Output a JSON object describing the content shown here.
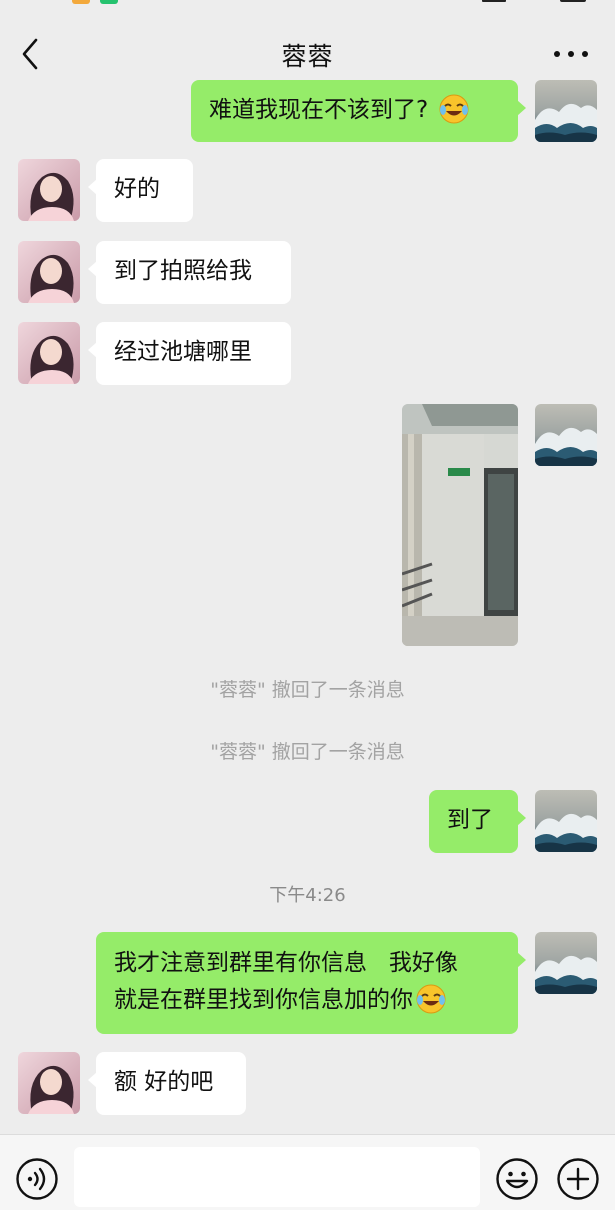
{
  "header": {
    "title": "蓉蓉"
  },
  "messages": [
    {
      "side": "out",
      "text": "难道我现在不该到了?",
      "emoji": "laughing-crying-emoji"
    },
    {
      "side": "in",
      "text": "好的"
    },
    {
      "side": "in",
      "text": "到了拍照给我"
    },
    {
      "side": "in",
      "text": "经过池塘哪里"
    },
    {
      "side": "out",
      "type": "photo"
    },
    {
      "side": "out",
      "text": "到了"
    },
    {
      "side": "out",
      "line1": "我才注意到群里有你信息   我好像",
      "line2": "就是在群里找到你信息加的你",
      "emoji": "laughing-crying-emoji"
    },
    {
      "side": "in",
      "text": "额 好的吧"
    }
  ],
  "system": {
    "recall1": "\"蓉蓉\" 撤回了一条消息",
    "recall2": "\"蓉蓉\" 撤回了一条消息",
    "time": "下午4:26"
  },
  "icons": {
    "back": "chevron-left-icon",
    "more": "more-dots-icon",
    "voice": "voice-icon",
    "emoji": "smiley-icon",
    "plus": "plus-icon"
  },
  "colors": {
    "background": "#ededed",
    "outgoing_bubble": "#95ec69",
    "incoming_bubble": "#ffffff"
  }
}
